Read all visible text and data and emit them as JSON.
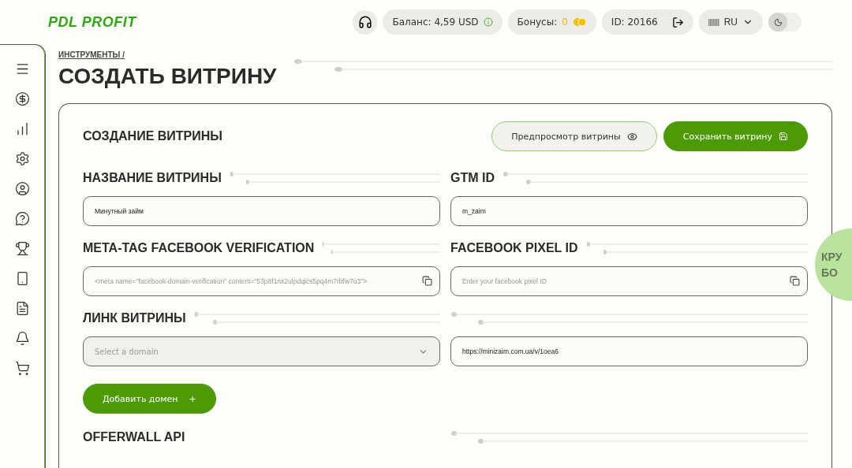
{
  "header": {
    "logo": "PDL PROFIT",
    "balance": "Баланс: 4,59 USD",
    "bonus_label": "Бонусы:",
    "bonus_value": "0",
    "user_id": "ID: 20166",
    "language": "RU",
    "dark_mode": false
  },
  "breadcrumb": "ИНСТРУМЕНТЫ /",
  "page_title": "СОЗДАТЬ ВИТРИНУ",
  "card": {
    "title": "СОЗДАНИЕ ВИТРИНЫ",
    "preview_button": "Предпросмотр витрины",
    "save_button": "Сохранить витрину",
    "fields": [
      {
        "kind": "text",
        "label": "НАЗВАНИЕ ВИТРИНЫ",
        "value": "Минутный займ"
      },
      {
        "kind": "text",
        "label": "GTM ID",
        "value": "m_zaim"
      },
      {
        "kind": "copy",
        "label": "META-TAG FACEBOOK VERIFICATION",
        "placeholder": "<meta name=\"facebook-domain-verification\" content=\"53p8f1nx2ulpdqics5pq4m7rbfw7u3\">"
      },
      {
        "kind": "copy",
        "label": "FACEBOOK PIXEL ID",
        "placeholder": "Enter your facebook pixel ID"
      },
      {
        "kind": "select",
        "label": "ЛИНК ВИТРИНЫ",
        "placeholder": "Select a domain"
      },
      {
        "kind": "text",
        "value": "https://minizaim.com.ua/v/1oea6"
      }
    ],
    "add_domain_button": "Добавить домен",
    "add_icon": "+",
    "section_title": "OFFERWALL API"
  },
  "wheel_widget": {
    "lines": [
      "КРУ",
      "БО"
    ]
  }
}
